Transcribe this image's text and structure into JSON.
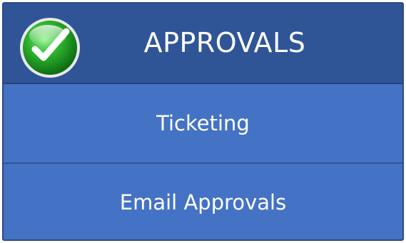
{
  "header": {
    "title": "APPROVALS",
    "icon": "check-circle-icon",
    "icon_color": "#2fb52f"
  },
  "items": [
    {
      "label": "Ticketing"
    },
    {
      "label": "Email Approvals"
    }
  ],
  "colors": {
    "header_bg": "#2f5597",
    "row_bg": "#4472c4",
    "border": "#2b4a80",
    "text": "#ffffff"
  }
}
